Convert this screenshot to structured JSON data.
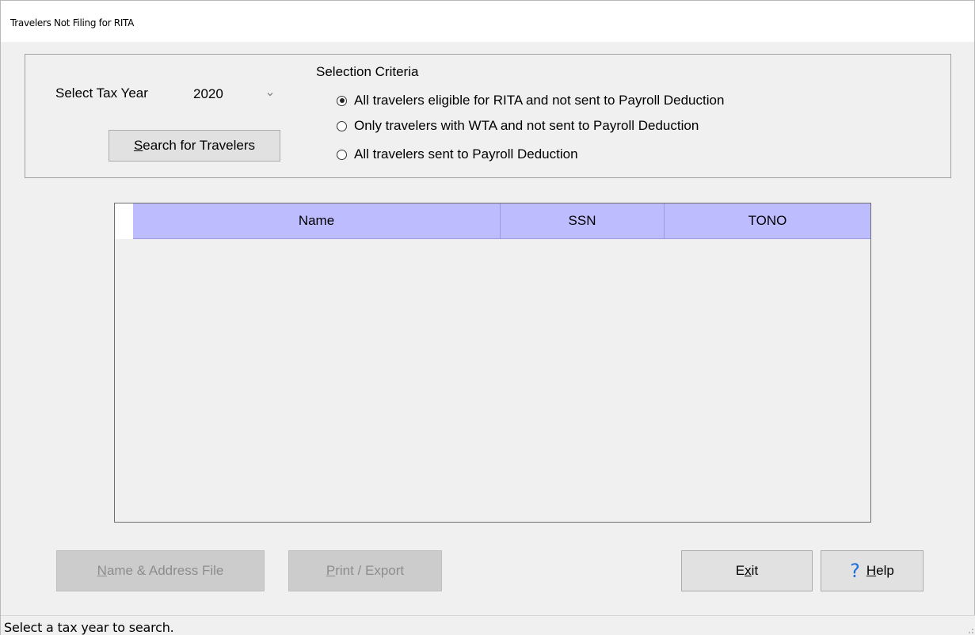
{
  "window": {
    "title": "Travelers Not Filing for RITA"
  },
  "tax_year": {
    "label": "Select Tax Year",
    "selected": "2020"
  },
  "search_button": {
    "accel": "S",
    "rest": "earch for Travelers"
  },
  "criteria": {
    "heading": "Selection Criteria",
    "options": [
      {
        "label": "All travelers eligible for RITA and not sent to Payroll Deduction",
        "checked": true
      },
      {
        "label": "Only travelers with WTA and not sent to Payroll Deduction",
        "checked": false
      },
      {
        "label": "All travelers sent to Payroll Deduction",
        "checked": false
      }
    ]
  },
  "grid": {
    "columns": [
      "Name",
      "SSN",
      "TONO"
    ],
    "rows": []
  },
  "buttons": {
    "name_address": {
      "accel": "N",
      "rest": "ame & Address File"
    },
    "print_export": {
      "accel": "P",
      "rest": "rint / Export"
    },
    "exit": {
      "pre": "E",
      "accel": "x",
      "rest": "it"
    },
    "help": {
      "accel": "H",
      "rest": "elp"
    }
  },
  "status": {
    "text": "Select a tax year to search."
  },
  "colors": {
    "header_bg": "#bcbcff",
    "help_icon": "#1f6fd8"
  }
}
